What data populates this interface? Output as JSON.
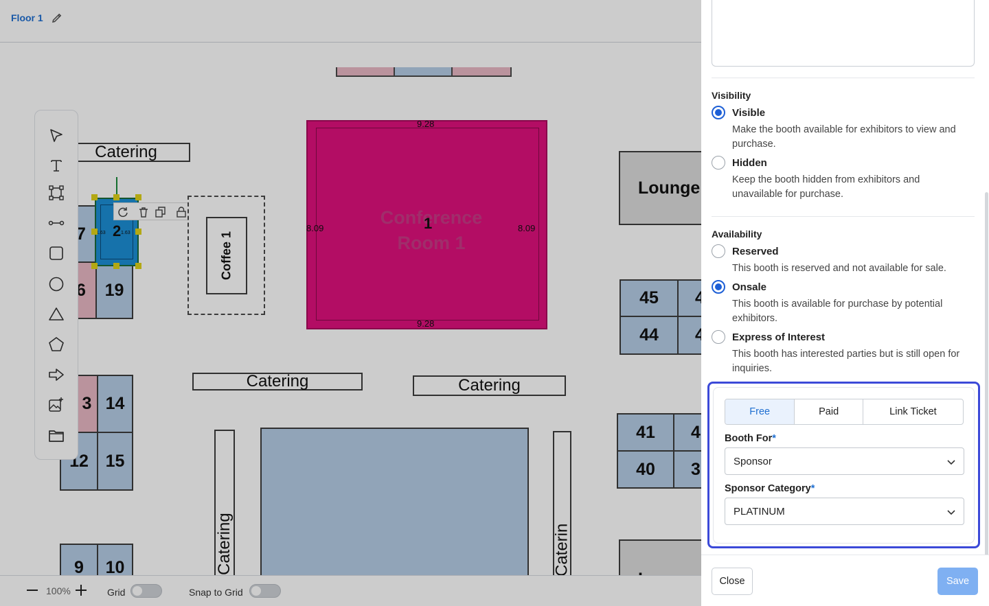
{
  "header": {
    "floor_name": "Floor 1"
  },
  "canvas": {
    "catering_label": "Catering",
    "catering_truncated_a": "Catering",
    "catering_truncated_b": "Caterin",
    "coffee_label": "Coffee 1",
    "lounge_label": "Lounge",
    "lounge_partial": "L",
    "conference": {
      "label": "Conference Room 1",
      "number": "1",
      "width_dim": "9.28",
      "height_dim": "8.09"
    },
    "selected_booth": {
      "number": "2",
      "dim_left": "1.63",
      "dim_right": "1.63"
    },
    "booths": [
      "7",
      "6",
      "19",
      "3",
      "14",
      "12",
      "15",
      "9",
      "10",
      "45",
      "44",
      "41",
      "40",
      "4",
      "4",
      "4",
      "3"
    ]
  },
  "bottom_bar": {
    "zoom": "100%",
    "grid_label": "Grid",
    "snap_label": "Snap to Grid"
  },
  "panel": {
    "visibility": {
      "title": "Visibility",
      "options": [
        {
          "label": "Visible",
          "desc": "Make the booth available for exhibitors to view and purchase.",
          "checked": true
        },
        {
          "label": "Hidden",
          "desc": "Keep the booth hidden from exhibitors and unavailable for purchase.",
          "checked": false
        }
      ]
    },
    "availability": {
      "title": "Availability",
      "options": [
        {
          "label": "Reserved",
          "desc": "This booth is reserved and not available for sale.",
          "checked": false
        },
        {
          "label": "Onsale",
          "desc": "This booth is available for purchase by potential exhibitors.",
          "checked": true
        },
        {
          "label": "Express of Interest",
          "desc": "This booth has interested parties but is still open for inquiries.",
          "checked": false
        }
      ]
    },
    "pricing_tabs": [
      "Free",
      "Paid",
      "Link Ticket"
    ],
    "active_tab": "Free",
    "booth_for": {
      "label": "Booth For",
      "required": "*",
      "value": "Sponsor"
    },
    "sponsor_category": {
      "label": "Sponsor Category",
      "required": "*",
      "value": "PLATINUM"
    },
    "footer": {
      "close": "Close",
      "save": "Save"
    }
  },
  "colors": {
    "accent": "#1d5fd6",
    "highlight_border": "#3b49d8",
    "conference_fill": "#e0117d",
    "booth_fill": "#b6cde6",
    "selected_booth": "#1c8fd6"
  }
}
